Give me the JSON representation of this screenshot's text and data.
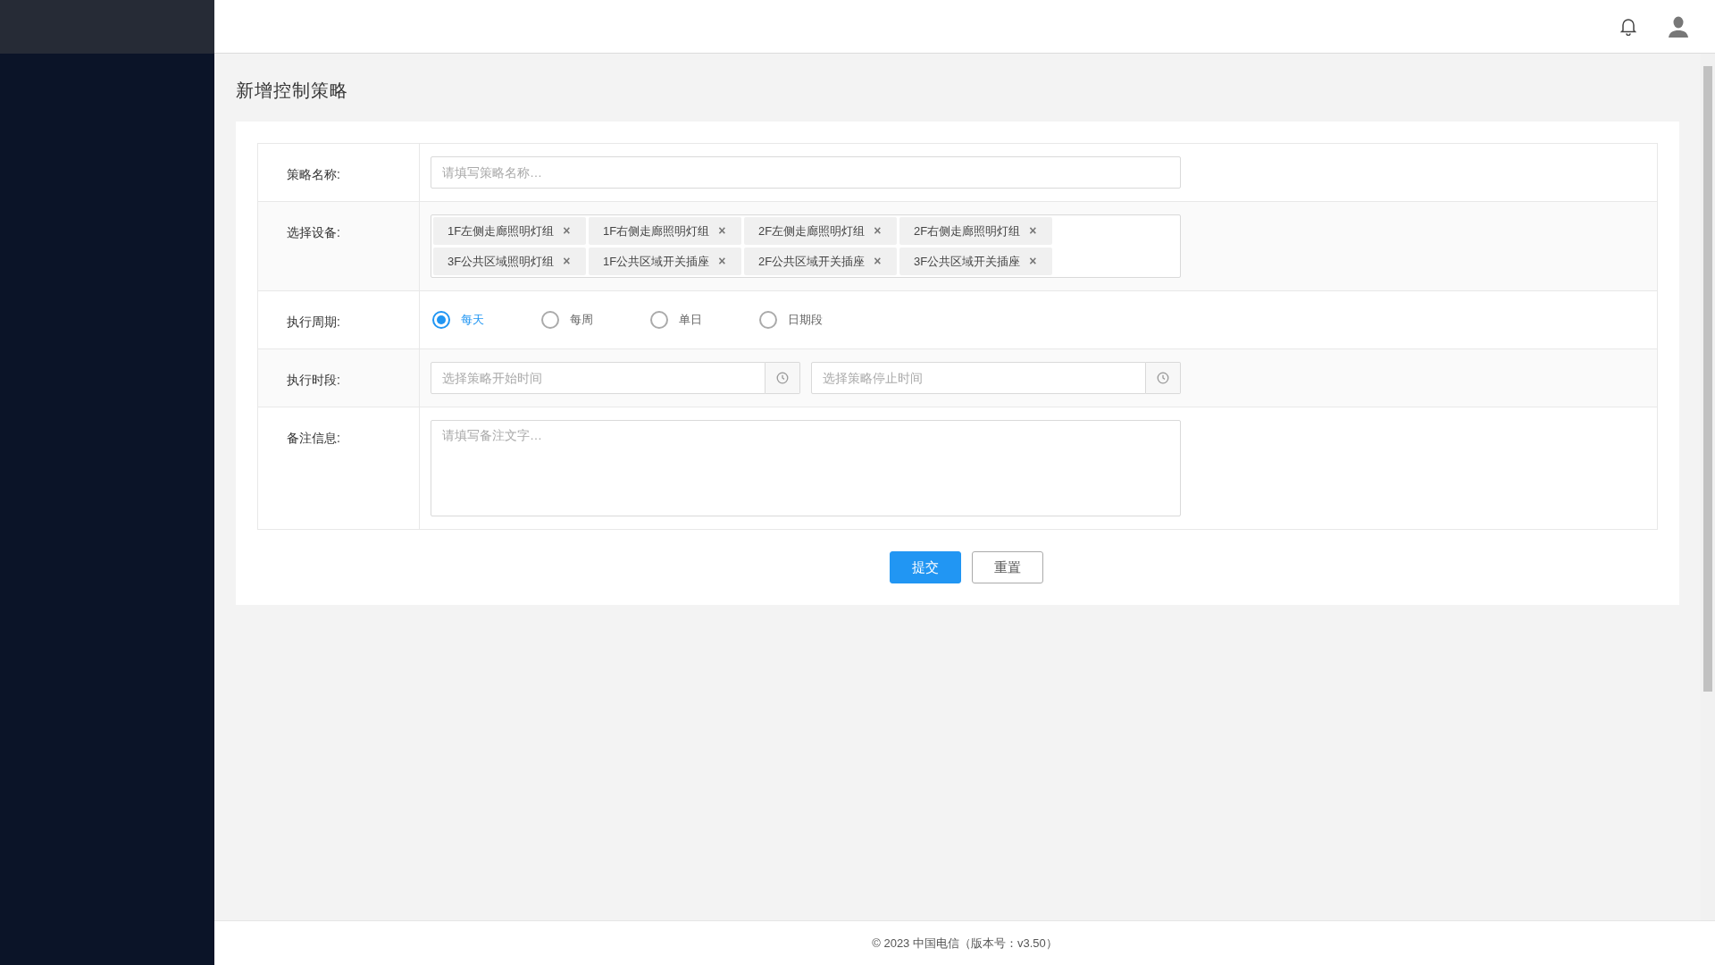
{
  "page_title": "新增控制策略",
  "form": {
    "name": {
      "label": "策略名称:",
      "placeholder": "请填写策略名称…"
    },
    "devices": {
      "label": "选择设备:",
      "tags": [
        {
          "text": "1F左侧走廊照明灯组",
          "remove": "×"
        },
        {
          "text": "1F右侧走廊照明灯组",
          "remove": "×"
        },
        {
          "text": "2F左侧走廊照明灯组",
          "remove": "×"
        },
        {
          "text": "2F右侧走廊照明灯组",
          "remove": "×"
        },
        {
          "text": "3F公共区域照明灯组",
          "remove": "×"
        },
        {
          "text": "1F公共区域开关插座",
          "remove": "×"
        },
        {
          "text": "2F公共区域开关插座",
          "remove": "×"
        },
        {
          "text": "3F公共区域开关插座",
          "remove": "×"
        }
      ]
    },
    "cycle": {
      "label": "执行周期:",
      "options": [
        {
          "label": "每天",
          "selected": true
        },
        {
          "label": "每周",
          "selected": false
        },
        {
          "label": "单日",
          "selected": false
        },
        {
          "label": "日期段",
          "selected": false
        }
      ]
    },
    "period": {
      "label": "执行时段:",
      "start_placeholder": "选择策略开始时间",
      "end_placeholder": "选择策略停止时间"
    },
    "remark": {
      "label": "备注信息:",
      "placeholder": "请填写备注文字…"
    },
    "buttons": [
      {
        "label": "提交",
        "kind": "primary"
      },
      {
        "label": "重置",
        "kind": "default"
      }
    ]
  },
  "footer": "© 2023 中国电信（版本号：v3.50）"
}
